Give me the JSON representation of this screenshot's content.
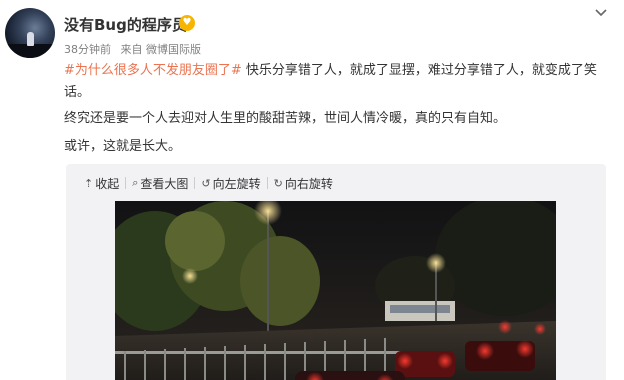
{
  "author": {
    "name": "没有Bug的程序员",
    "badge_icon": "heart-eyes-emoji-icon"
  },
  "meta": {
    "time": "38分钟前",
    "source": "来自 微博国际版"
  },
  "post": {
    "topic": "#为什么很多人不发朋友圈了#",
    "line1_rest": " 快乐分享错了人，就成了显摆，难过分享错了人，就变成了笑话。",
    "line2": "终究还是要一个人去迎对人生里的酸甜苦辣，世间人情冷暖，真的只有自知。",
    "line3": "或许，这就是长大。"
  },
  "media_toolbar": {
    "collapse": "收起",
    "view_large": "查看大图",
    "rotate_left": "向左旋转",
    "rotate_right": "向右旋转"
  },
  "colors": {
    "topic": "#eb7350",
    "text": "#333333",
    "meta": "#808080",
    "card_bg": "#f2f2f5"
  }
}
